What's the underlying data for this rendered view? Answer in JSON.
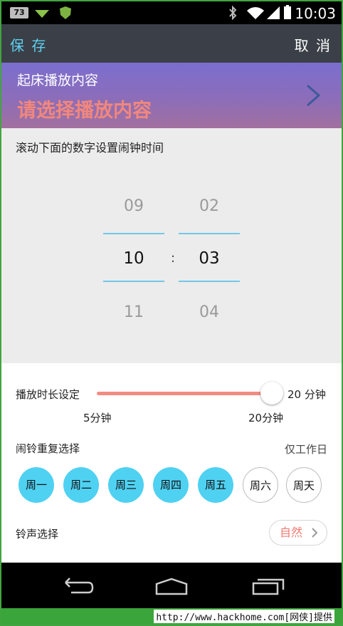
{
  "status_bar": {
    "badge": "73",
    "time": "10:03"
  },
  "app_bar": {
    "save_label": "保 存",
    "cancel_label": "取 消"
  },
  "banner": {
    "title": "起床播放内容",
    "prompt": "请选择播放内容"
  },
  "picker": {
    "hint": "滚动下面的数字设置闹钟时间",
    "hours": {
      "prev": "09",
      "current": "10",
      "next": "11"
    },
    "minutes": {
      "prev": "02",
      "current": "03",
      "next": "04"
    },
    "separator": ":"
  },
  "duration": {
    "label": "播放时长设定",
    "value_label": "20 分钟",
    "min_label": "5分钟",
    "max_label": "20分钟",
    "level": 1.0,
    "track_color": "#f28b82"
  },
  "repeat": {
    "label": "闹铃重复选择",
    "summary": "仅工作日",
    "days": [
      {
        "label": "周一",
        "selected": true
      },
      {
        "label": "周二",
        "selected": true
      },
      {
        "label": "周三",
        "selected": true
      },
      {
        "label": "周四",
        "selected": true
      },
      {
        "label": "周五",
        "selected": true
      },
      {
        "label": "周六",
        "selected": false
      },
      {
        "label": "周天",
        "selected": false
      }
    ],
    "selected_color": "#4fd1f2"
  },
  "ringtone": {
    "label": "铃声选择",
    "value": "自然"
  },
  "watermark": {
    "text": "http://www.hackhome.com[网侠]提供"
  },
  "colors": {
    "accent_blue": "#5fd0ef",
    "accent_coral": "#f2877c",
    "app_bar": "#3b4048"
  }
}
